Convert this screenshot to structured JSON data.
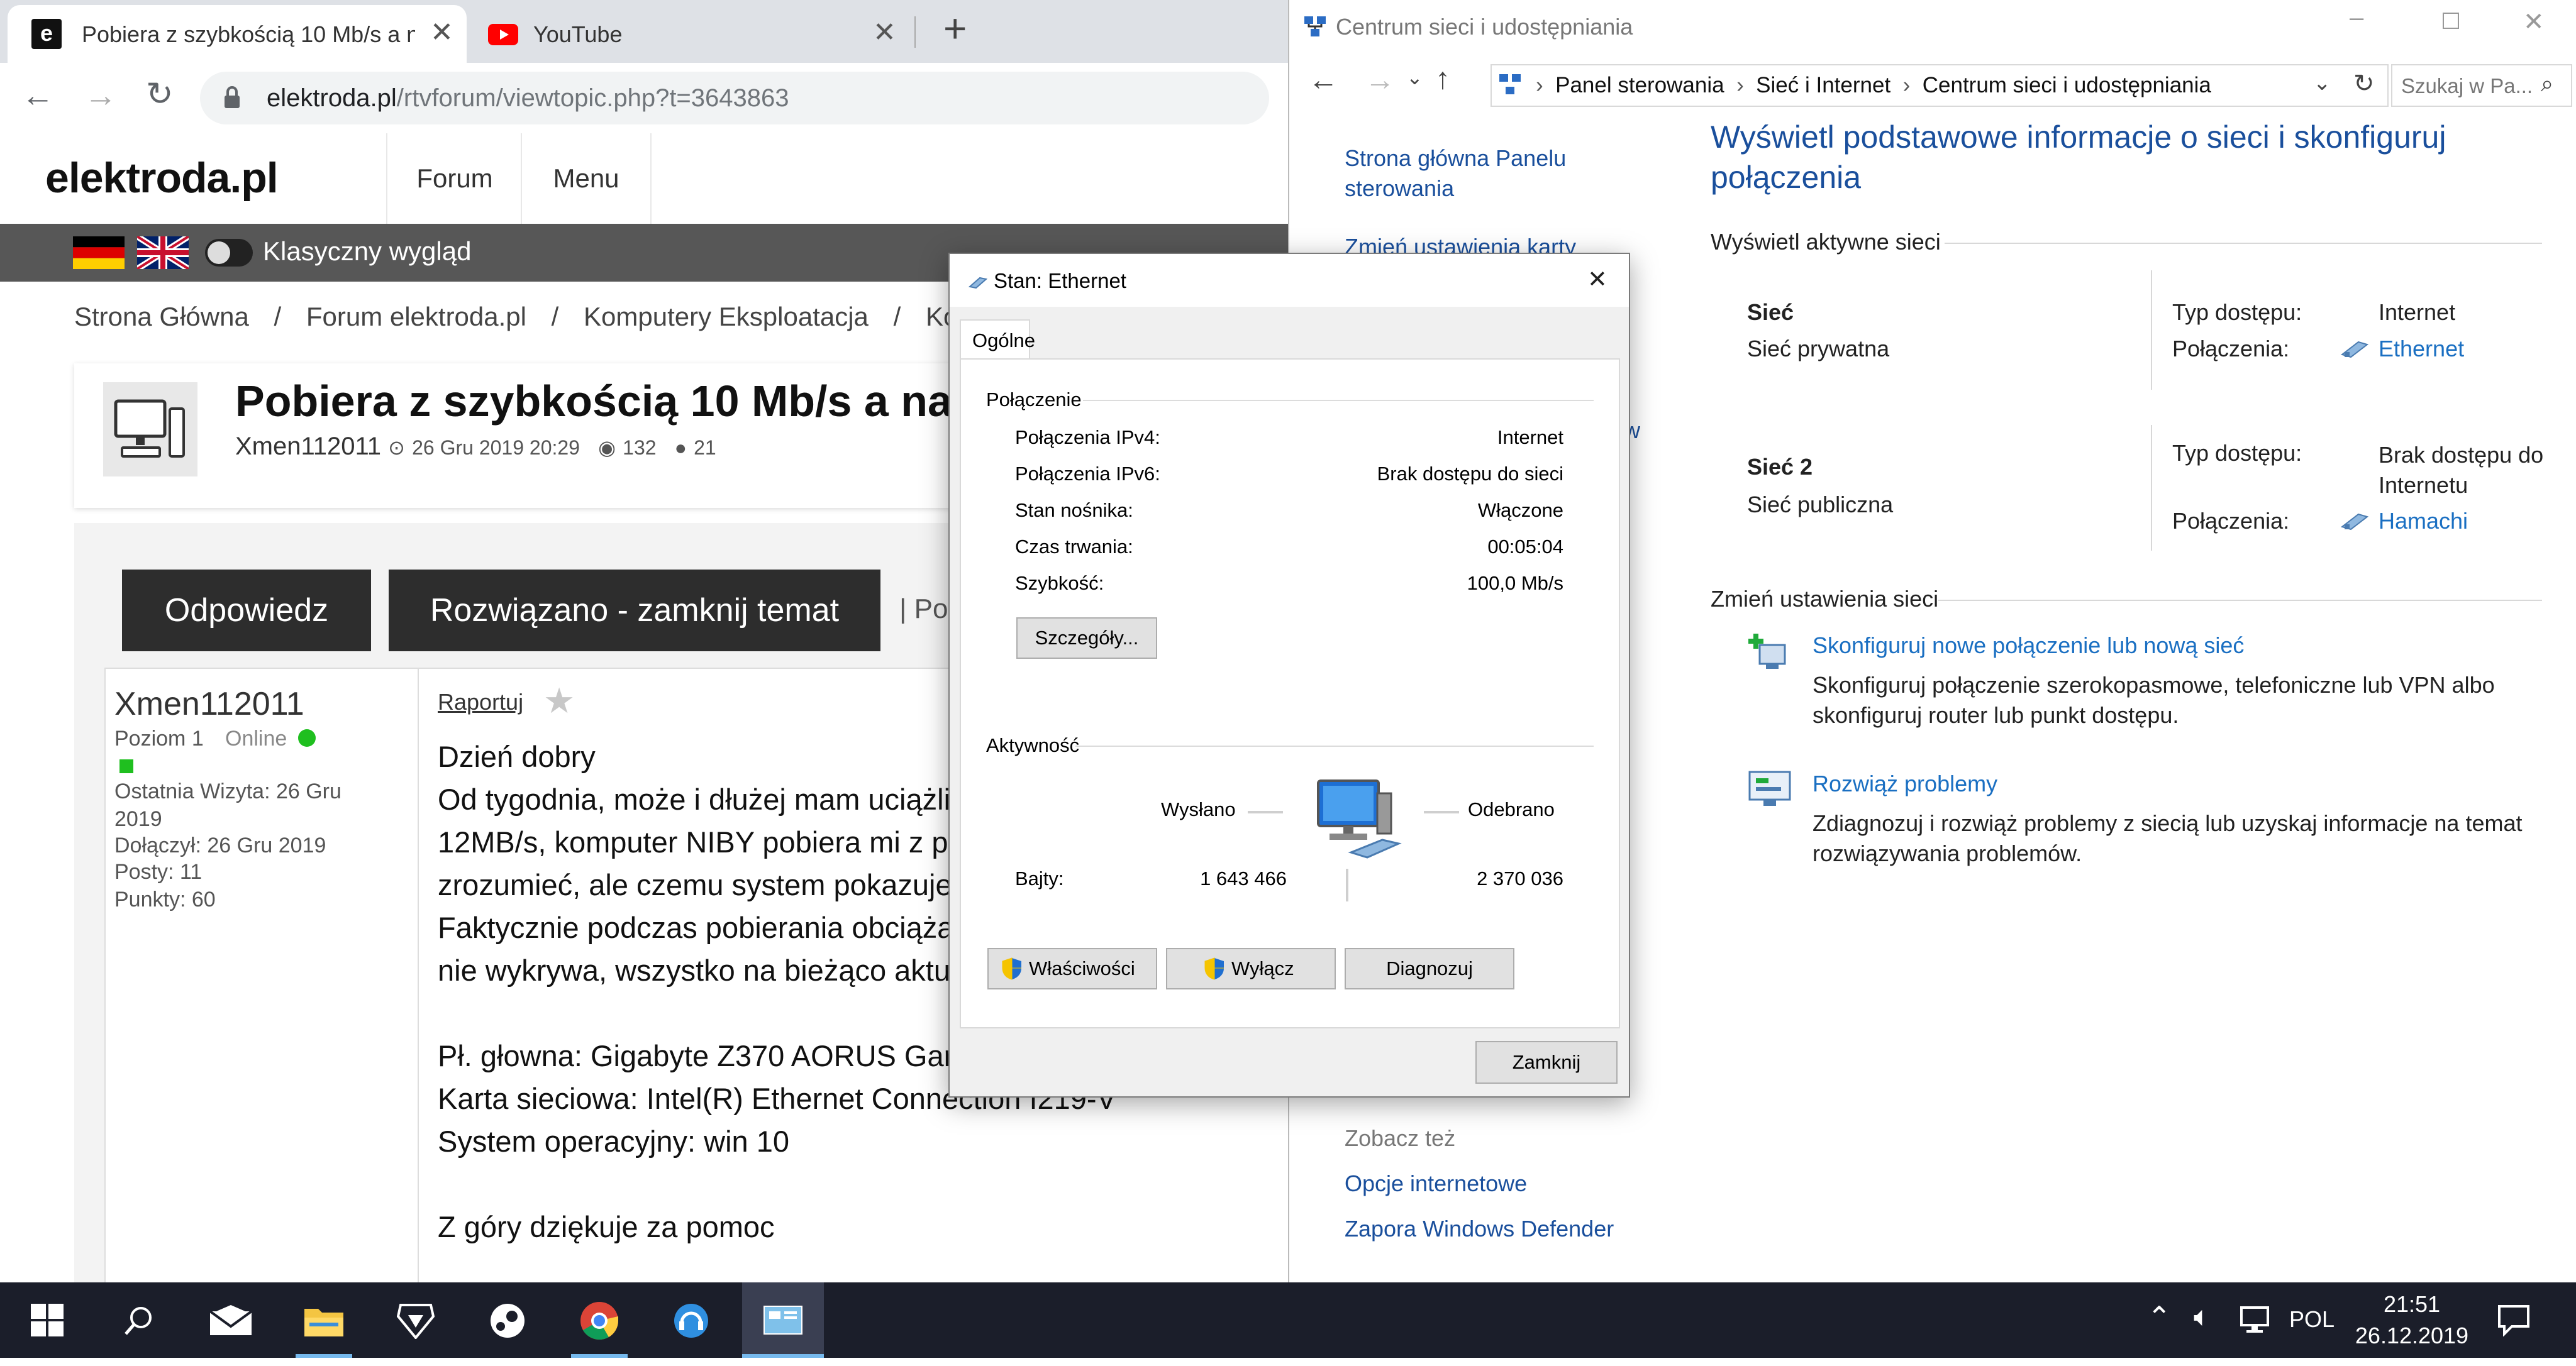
{
  "browser": {
    "tabs": [
      {
        "title": "Pobiera z szybkością 10 Mb/s a n",
        "icon": "elektroda-favicon"
      },
      {
        "title": "YouTube",
        "icon": "youtube-favicon"
      }
    ],
    "new_tab": "+",
    "url_domain": "elektroda.pl",
    "url_path": "/rtvforum/viewtopic.php?t=3643863"
  },
  "site": {
    "logo": "elektroda.pl",
    "nav": [
      "Forum",
      "Menu"
    ],
    "classic_toggle_label": "Klasyczny wygląd",
    "breadcrumbs": [
      "Strona Główna",
      "/",
      "Forum elektroda.pl",
      "/",
      "Komputery Eksploatacja",
      "/",
      "Komp"
    ],
    "topic_title": "Pobiera z szybkością 10 Mb/s a nap",
    "topic_author": "Xmen112011",
    "topic_date": "26 Gru 2019 20:29",
    "topic_views": "132",
    "topic_replies": "21",
    "btn_reply": "Odpowiedz",
    "btn_solved": "Rozwiązano - zamknij temat",
    "btn_more": "| Po",
    "user": {
      "name": "Xmen112011",
      "level": "Poziom 1",
      "status": "Online",
      "last_visit_1": "Ostatnia Wizyta: 26 Gru",
      "last_visit_2": "2019",
      "joined": "Dołączył: 26 Gru 2019",
      "posts": "Posty: 11",
      "points": "Punkty: 60"
    },
    "report": "Raportuj",
    "post_lines": [
      "Dzień dobry",
      "Od tygodnia, może i dłużej mam uciążli",
      "12MB/s, komputer NIBY pobiera mi z p",
      "zrozumieć, ale czemu system pokazuje",
      "Faktycznie podczas pobierania obciąża",
      "nie wykrywa, wszystko na bieżąco aktu",
      "",
      "Pł. głowna: Gigabyte Z370 AORUS Gar",
      "Karta sieciowa: Intel(R) Ethernet Connection I219-V",
      "System operacyjny: win 10",
      "",
      "Z góry dziękuje za pomoc"
    ]
  },
  "control_panel": {
    "window_title": "Centrum sieci i udostępniania",
    "breadcrumb": [
      "Panel sterowania",
      "Sieć i Internet",
      "Centrum sieci i udostępniania"
    ],
    "search_placeholder": "Szukaj w Pa...",
    "left_links": [
      "Strona główna Panelu sterowania",
      "Zmień ustawienia karty"
    ],
    "left_partial": "w",
    "heading": "Wyświetl podstawowe informacje o sieci i skonfiguruj połączenia",
    "active_networks_label": "Wyświetl aktywne sieci",
    "networks": [
      {
        "name": "Sieć",
        "type": "Sieć prywatna",
        "access_label": "Typ dostępu:",
        "access": "Internet",
        "conn_label": "Połączenia:",
        "conn": "Ethernet"
      },
      {
        "name": "Sieć 2",
        "type": "Sieć publiczna",
        "access_label": "Typ dostępu:",
        "access": "Brak dostępu do Internetu",
        "conn_label": "Połączenia:",
        "conn": "Hamachi"
      }
    ],
    "change_label": "Zmień ustawienia sieci",
    "tasks": [
      {
        "link": "Skonfiguruj nowe połączenie lub nową sieć",
        "desc": "Skonfiguruj połączenie szerokopasmowe, telefoniczne lub VPN albo skonfiguruj router lub punkt dostępu."
      },
      {
        "link": "Rozwiąż problemy",
        "desc": "Zdiagnozuj i rozwiąż problemy z siecią lub uzyskaj informacje na temat rozwiązywania problemów."
      }
    ],
    "see_also": "Zobacz też",
    "see_also_links": [
      "Opcje internetowe",
      "Zapora Windows Defender"
    ]
  },
  "dialog": {
    "title": "Stan: Ethernet",
    "tab": "Ogólne",
    "connection_group": "Połączenie",
    "rows": [
      {
        "label": "Połączenia IPv4:",
        "value": "Internet"
      },
      {
        "label": "Połączenia IPv6:",
        "value": "Brak dostępu do sieci"
      },
      {
        "label": "Stan nośnika:",
        "value": "Włączone"
      },
      {
        "label": "Czas trwania:",
        "value": "00:05:04"
      },
      {
        "label": "Szybkość:",
        "value": "100,0 Mb/s"
      }
    ],
    "details_btn": "Szczegóły...",
    "activity_group": "Aktywność",
    "sent_label": "Wysłano",
    "received_label": "Odebrano",
    "bytes_label": "Bajty:",
    "bytes_sent": "1 643 466",
    "bytes_received": "2 370 036",
    "btn_properties": "Właściwości",
    "btn_disable": "Wyłącz",
    "btn_diagnose": "Diagnozuj",
    "btn_close": "Zamknij"
  },
  "taskbar": {
    "apps": [
      "start-icon",
      "search-icon",
      "mail-icon",
      "file-explorer-icon",
      "msi-dragon-icon",
      "steam-icon",
      "chrome-icon",
      "support-headset-icon",
      "control-panel-icon"
    ],
    "language": "POL",
    "time": "21:51",
    "date": "26.12.2019"
  },
  "colors": {
    "accent_link": "#1a6fc2",
    "cp_heading": "#1a4f9c",
    "taskbar": "#1b1e2a",
    "online": "#1fbf1f"
  }
}
